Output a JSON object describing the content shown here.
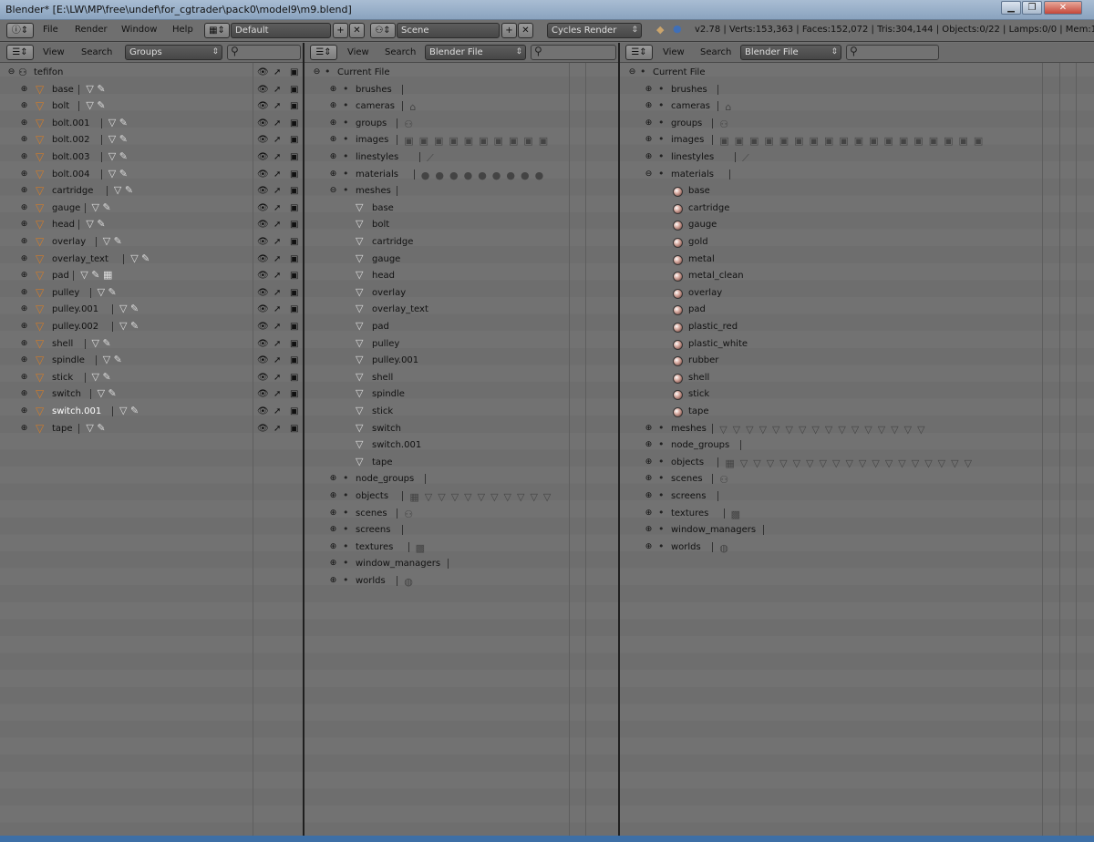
{
  "window": {
    "title": "Blender* [E:\\LW\\MP\\free\\undef\\for_cgtrader\\pack0\\model9\\m9.blend]",
    "min": "▁",
    "max": "❐",
    "close": "✕"
  },
  "infobar": {
    "menus": [
      "File",
      "Render",
      "Window",
      "Help"
    ],
    "layout": "Default",
    "scene": "Scene",
    "engine": "Cycles Render",
    "stats": "v2.78 | Verts:153,363 | Faces:152,072 | Tris:304,144 | Objects:0/22 | Lamps:0/0 | Mem:11"
  },
  "panel1": {
    "menus": [
      "View",
      "Search"
    ],
    "display_mode": "Groups",
    "root": "tefifon",
    "objects": [
      {
        "name": "base",
        "icons": "▽ ✎"
      },
      {
        "name": "bolt",
        "icons": "▽ ✎"
      },
      {
        "name": "bolt.001",
        "icons": "▽ ✎"
      },
      {
        "name": "bolt.002",
        "icons": "▽ ✎"
      },
      {
        "name": "bolt.003",
        "icons": "▽ ✎"
      },
      {
        "name": "bolt.004",
        "icons": "▽ ✎"
      },
      {
        "name": "cartridge",
        "icons": "▽ ✎"
      },
      {
        "name": "gauge",
        "icons": "▽ ✎"
      },
      {
        "name": "head",
        "icons": "▽ ✎"
      },
      {
        "name": "overlay",
        "icons": "▽ ✎"
      },
      {
        "name": "overlay_text",
        "icons": "▽ ✎"
      },
      {
        "name": "pad",
        "icons": "▽ ✎ ▦"
      },
      {
        "name": "pulley",
        "icons": "▽ ✎"
      },
      {
        "name": "pulley.001",
        "icons": "▽ ✎"
      },
      {
        "name": "pulley.002",
        "icons": "▽ ✎"
      },
      {
        "name": "shell",
        "icons": "▽ ✎"
      },
      {
        "name": "spindle",
        "icons": "▽ ✎"
      },
      {
        "name": "stick",
        "icons": "▽ ✎"
      },
      {
        "name": "switch",
        "icons": "▽ ✎"
      },
      {
        "name": "switch.001",
        "icons": "▽ ✎"
      },
      {
        "name": "tape",
        "icons": "▽ ✎"
      }
    ]
  },
  "panel2": {
    "menus": [
      "View",
      "Search"
    ],
    "display_mode": "Blender File",
    "root": "Current File",
    "sections_before": [
      {
        "name": "brushes",
        "icons": ""
      },
      {
        "name": "cameras",
        "icons": "⌂"
      },
      {
        "name": "groups",
        "icons": "⚇"
      },
      {
        "name": "images",
        "icons": "▣▣▣▣▣▣▣▣▣▣"
      },
      {
        "name": "linestyles",
        "icons": "⟋"
      },
      {
        "name": "materials",
        "icons": "●●●●●●●●●"
      },
      {
        "name": "meshes",
        "icons": ""
      }
    ],
    "meshes": [
      "base",
      "bolt",
      "cartridge",
      "gauge",
      "head",
      "overlay",
      "overlay_text",
      "pad",
      "pulley",
      "pulley.001",
      "shell",
      "spindle",
      "stick",
      "switch",
      "switch.001",
      "tape"
    ],
    "sections_after": [
      {
        "name": "node_groups",
        "icons": ""
      },
      {
        "name": "objects",
        "icons": "▦▽▽▽▽▽▽▽▽▽▽"
      },
      {
        "name": "scenes",
        "icons": "⚇"
      },
      {
        "name": "screens",
        "icons": ""
      },
      {
        "name": "textures",
        "icons": "▩"
      },
      {
        "name": "window_managers",
        "icons": ""
      },
      {
        "name": "worlds",
        "icons": "◍"
      }
    ]
  },
  "panel3": {
    "menus": [
      "View",
      "Search"
    ],
    "display_mode": "Blender File",
    "root": "Current File",
    "sections_before": [
      {
        "name": "brushes",
        "icons": ""
      },
      {
        "name": "cameras",
        "icons": "⌂"
      },
      {
        "name": "groups",
        "icons": "⚇"
      },
      {
        "name": "images",
        "icons": "▣▣▣▣▣▣▣▣▣▣▣▣▣▣▣▣▣▣"
      },
      {
        "name": "linestyles",
        "icons": "⟋"
      },
      {
        "name": "materials",
        "icons": ""
      }
    ],
    "materials": [
      "base",
      "cartridge",
      "gauge",
      "gold",
      "metal",
      "metal_clean",
      "overlay",
      "pad",
      "plastic_red",
      "plastic_white",
      "rubber",
      "shell",
      "stick",
      "tape"
    ],
    "sections_after": [
      {
        "name": "meshes",
        "icons": "▽▽▽▽▽▽▽▽▽▽▽▽▽▽▽▽"
      },
      {
        "name": "node_groups",
        "icons": ""
      },
      {
        "name": "objects",
        "icons": "▦▽▽▽▽▽▽▽▽▽▽▽▽▽▽▽▽▽▽"
      },
      {
        "name": "scenes",
        "icons": "⚇"
      },
      {
        "name": "screens",
        "icons": ""
      },
      {
        "name": "textures",
        "icons": "▩"
      },
      {
        "name": "window_managers",
        "icons": ""
      },
      {
        "name": "worlds",
        "icons": "◍"
      }
    ]
  }
}
